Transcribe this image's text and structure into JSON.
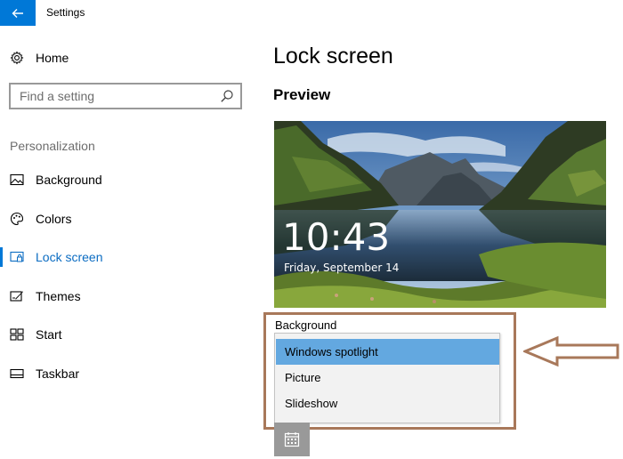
{
  "window": {
    "title": "Settings"
  },
  "sidebar": {
    "home_label": "Home",
    "search_placeholder": "Find a setting",
    "section_label": "Personalization",
    "items": [
      {
        "label": "Background",
        "icon": "image-icon",
        "active": false
      },
      {
        "label": "Colors",
        "icon": "palette-icon",
        "active": false
      },
      {
        "label": "Lock screen",
        "icon": "lock-screen-icon",
        "active": true
      },
      {
        "label": "Themes",
        "icon": "themes-icon",
        "active": false
      },
      {
        "label": "Start",
        "icon": "start-icon",
        "active": false
      },
      {
        "label": "Taskbar",
        "icon": "taskbar-icon",
        "active": false
      }
    ]
  },
  "main": {
    "title": "Lock screen",
    "preview_heading": "Preview",
    "preview": {
      "time": "10:43",
      "date": "Friday, September 14"
    },
    "background_label": "Background",
    "dropdown_options": [
      {
        "label": "Windows spotlight",
        "selected": true
      },
      {
        "label": "Picture",
        "selected": false
      },
      {
        "label": "Slideshow",
        "selected": false
      }
    ]
  },
  "colors": {
    "accent": "#0078d7",
    "selected_option": "#63a8e0",
    "annotation": "#a8785a"
  }
}
